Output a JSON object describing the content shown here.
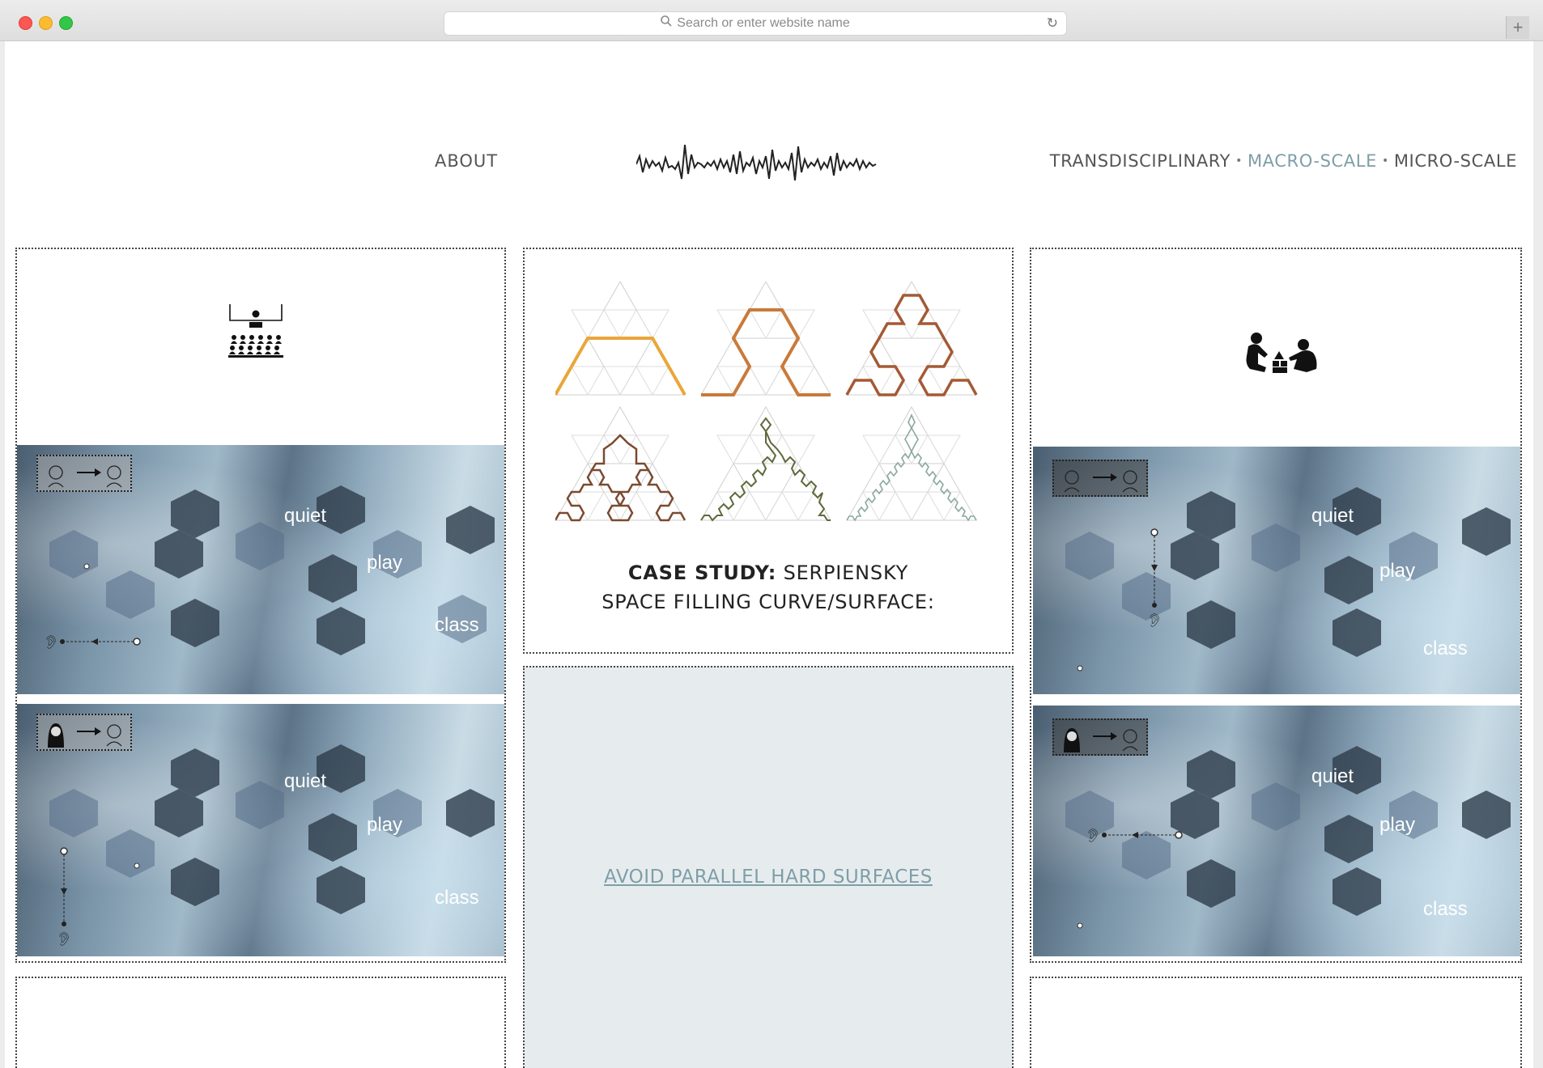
{
  "browser": {
    "url_placeholder": "Search or enter website name",
    "new_tab_label": "+"
  },
  "header": {
    "about": "ABOUT",
    "nav": [
      {
        "label": "TRANSDISCIPLINARY",
        "active": false
      },
      {
        "label": "MACRO-SCALE",
        "active": true
      },
      {
        "label": "MICRO-SCALE",
        "active": false
      }
    ],
    "separator": "•"
  },
  "photo_labels": {
    "quiet": "quiet",
    "play": "play",
    "class": "class"
  },
  "case_study": {
    "bold": "CASE STUDY:",
    "name": "SERPIENSKY",
    "subtitle": "SPACE FILLING CURVE/SURFACE:"
  },
  "link_text": "AVOID PARALLEL HARD SURFACES",
  "colors": {
    "accent": "#7f9ea7",
    "text": "#555555",
    "curve1": "#e9a63a",
    "curve2": "#c97a3a",
    "curve3": "#a35a35",
    "curve4": "#7a4a30",
    "curve5": "#5e6a3a",
    "curve6": "#8aa7a0"
  },
  "icons": {
    "classroom": "classroom-icon",
    "play": "children-playing-icon",
    "logo": "sound-wave-logo"
  }
}
